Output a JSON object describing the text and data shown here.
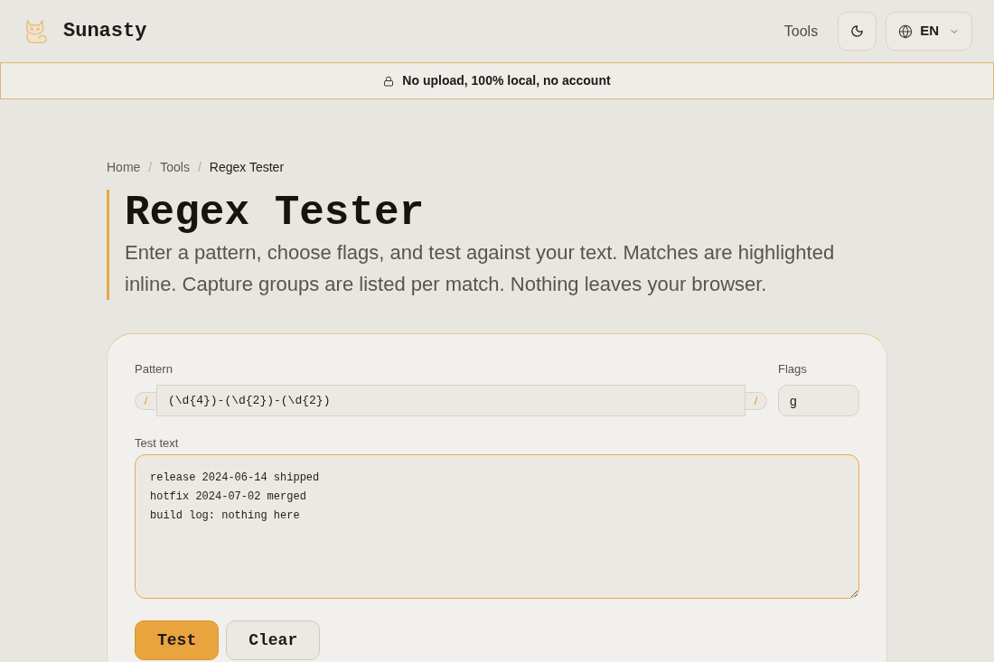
{
  "header": {
    "logo_text": "Sunasty",
    "nav_link": "Tools",
    "language": "EN"
  },
  "banner": {
    "text": "No upload, 100% local, no account"
  },
  "breadcrumb": [
    {
      "kind": "link",
      "label": "Home"
    },
    {
      "kind": "separator",
      "label": "/"
    },
    {
      "kind": "link",
      "label": "Tools"
    },
    {
      "kind": "separator",
      "label": "/"
    },
    {
      "kind": "current",
      "label": "Regex Tester"
    }
  ],
  "title": "Regex Tester",
  "description": "Enter a pattern, choose flags, and test against your text. Matches are highlighted inline. Capture groups are listed per match. Nothing leaves your browser.",
  "form": {
    "pattern": {
      "label": "Pattern",
      "delimiter_left": "/",
      "value": "(\\d{4})-(\\d{2})-(\\d{2})",
      "delimiter_right": "/"
    },
    "flags": {
      "label": "Flags",
      "value": "g"
    },
    "test_text": {
      "label": "Test text",
      "value": "release 2024-06-14 shipped\nhotfix 2024-07-02 merged\nbuild log: nothing here",
      "focused": true
    },
    "buttons": [
      {
        "label": "Test",
        "kind": "primary"
      },
      {
        "label": "Clear",
        "kind": "secondary"
      }
    ]
  }
}
